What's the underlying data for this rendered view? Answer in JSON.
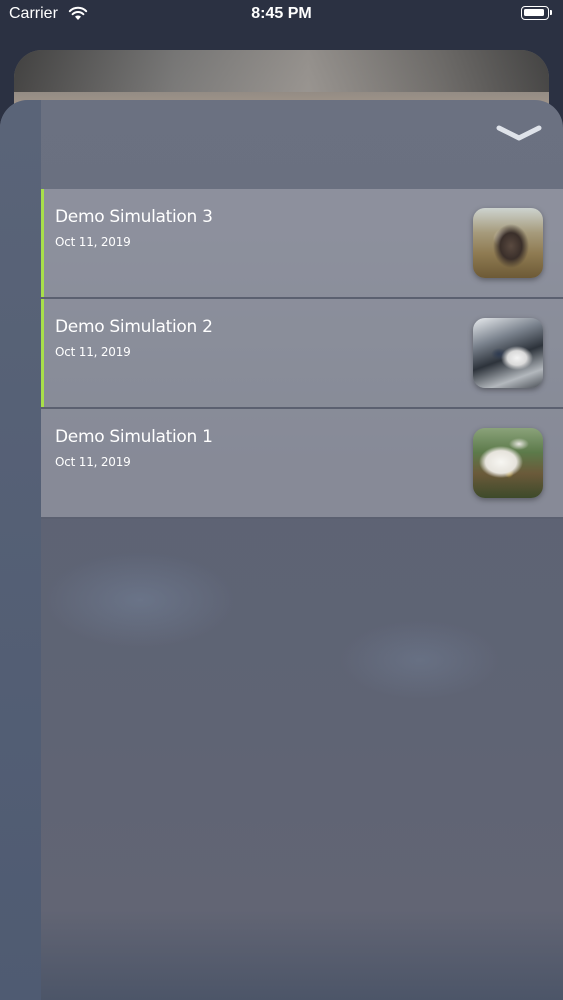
{
  "status_bar": {
    "carrier": "Carrier",
    "time": "8:45 PM"
  },
  "list": {
    "items": [
      {
        "title": "Demo Simulation 3",
        "date": "Oct 11, 2019",
        "thumbnail": "dog-photo"
      },
      {
        "title": "Demo Simulation 2",
        "date": "Oct 11, 2019",
        "thumbnail": "espresso-machine-photo"
      },
      {
        "title": "Demo Simulation 1",
        "date": "Oct 11, 2019",
        "thumbnail": "duck-photo"
      }
    ]
  },
  "colors": {
    "accent": "#a8e04a",
    "background": "#2b3142",
    "rail": "#4f5b72"
  },
  "icons": {
    "collapse": "chevron-down-icon",
    "wifi": "wifi-icon",
    "battery": "battery-icon"
  }
}
